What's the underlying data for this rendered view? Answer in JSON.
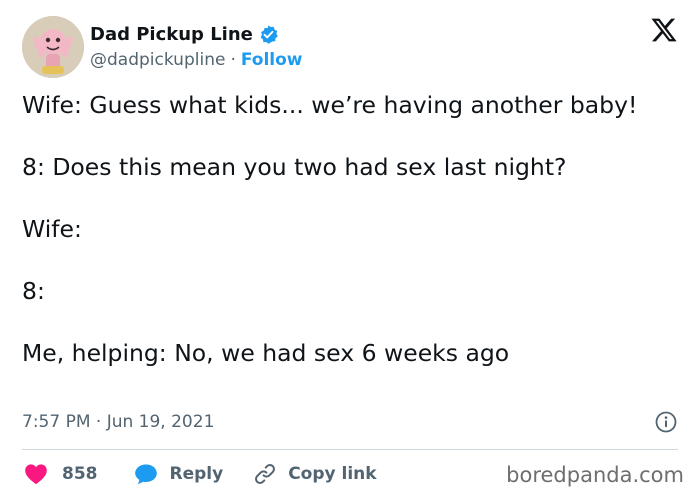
{
  "author": {
    "display_name": "Dad Pickup Line",
    "handle": "@dadpickupline",
    "separator": "·",
    "follow_label": "Follow",
    "verified": true,
    "avatar": "cartoon-character-avatar"
  },
  "tweet": {
    "lines": [
      "Wife: Guess what kids... we’re having another baby!",
      "8: Does this mean you two had sex last night?",
      "Wife:",
      "8:",
      "Me, helping: No, we had sex 6 weeks ago"
    ]
  },
  "meta": {
    "timestamp": "7:57 PM · Jun 19, 2021"
  },
  "actions": {
    "like_count": "858",
    "reply_label": "Reply",
    "copy_link_label": "Copy link"
  },
  "watermark": "boredpanda.com",
  "colors": {
    "accent": "#1d9bf0",
    "like": "#f91880",
    "secondary_text": "#536471",
    "text": "#0f1419",
    "divider": "#cfd9de"
  },
  "icons": [
    "verified-badge-icon",
    "x-logo-icon",
    "info-icon",
    "heart-icon",
    "reply-bubble-icon",
    "link-icon"
  ]
}
